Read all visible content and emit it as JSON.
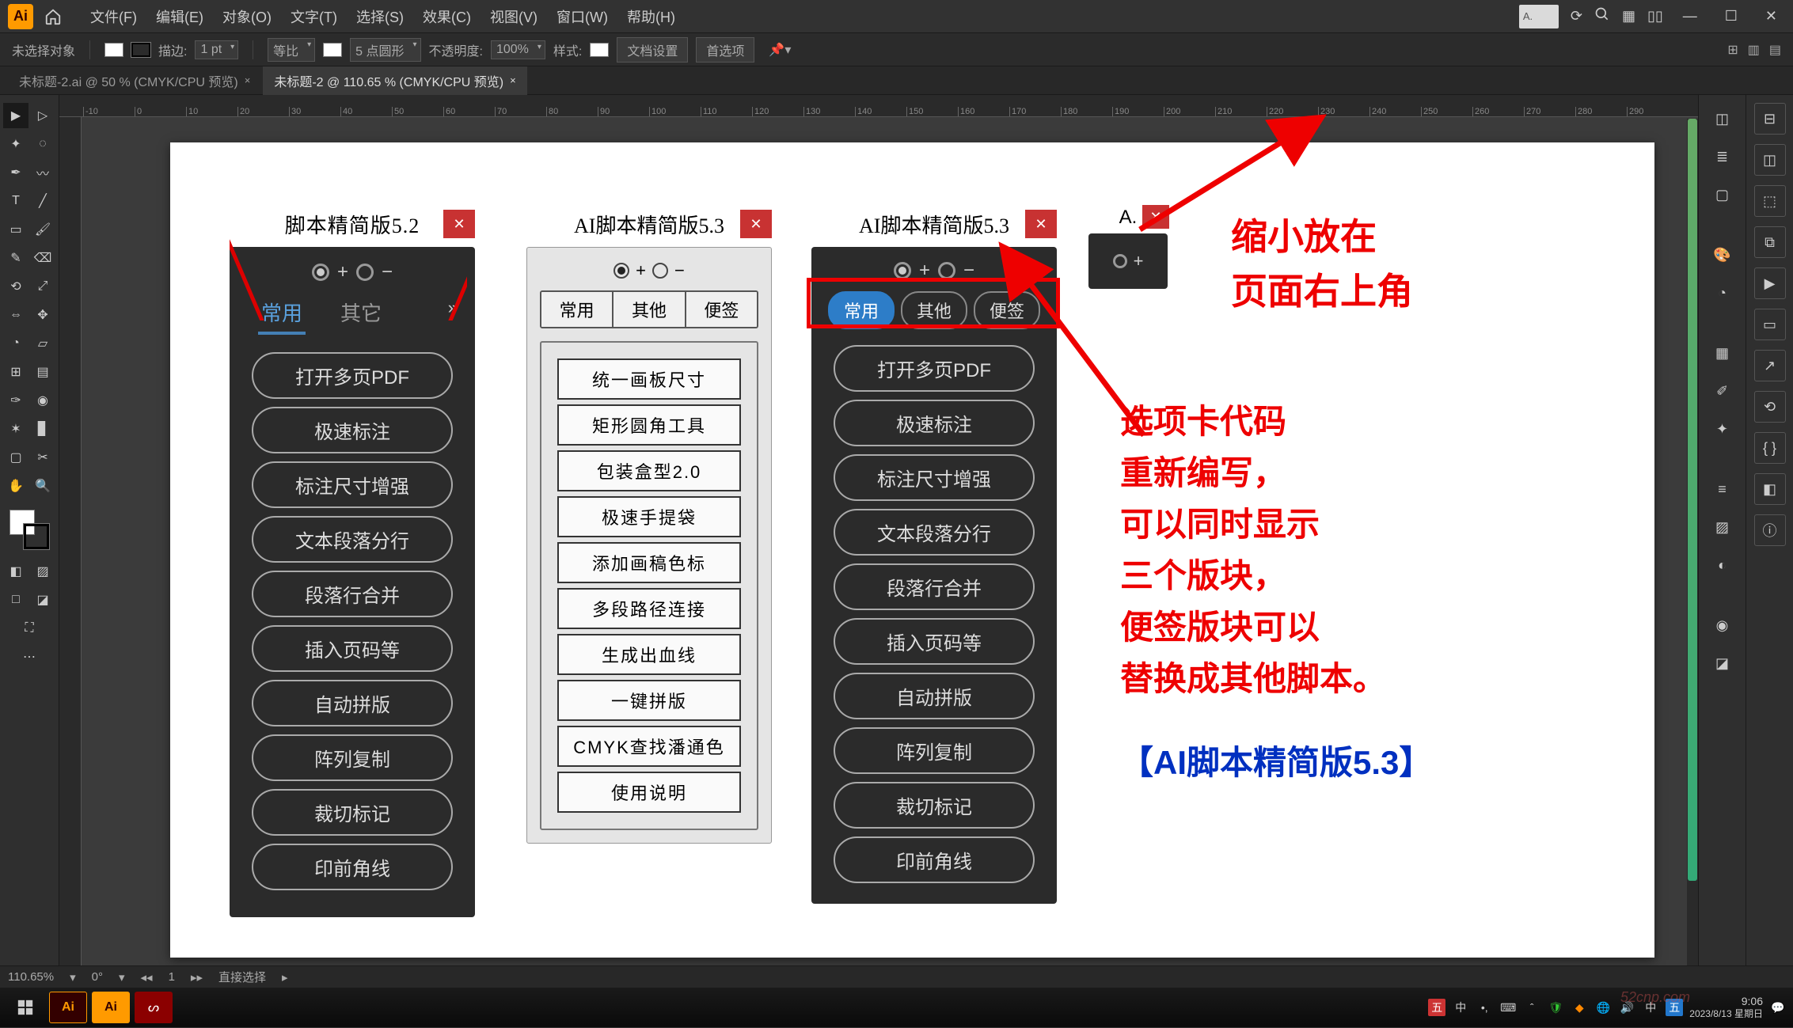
{
  "menubar": {
    "items": [
      "文件(F)",
      "编辑(E)",
      "对象(O)",
      "文字(T)",
      "选择(S)",
      "效果(C)",
      "视图(V)",
      "窗口(W)",
      "帮助(H)"
    ],
    "search_placeholder": "A..",
    "top_badge": "A."
  },
  "controlbar": {
    "no_selection": "未选择对象",
    "stroke_label": "描边:",
    "stroke_value": "1 pt",
    "uniform": "等比",
    "points_label": "5 点圆形",
    "opacity_label": "不透明度:",
    "opacity_value": "100%",
    "style_label": "样式:",
    "doc_setup": "文档设置",
    "prefs": "首选项"
  },
  "tabs": {
    "items": [
      {
        "label": "未标题-2.ai @ 50 % (CMYK/CPU 预览)",
        "active": false
      },
      {
        "label": "未标题-2 @ 110.65 % (CMYK/CPU 预览)",
        "active": true
      }
    ]
  },
  "ruler": {
    "marks": [
      "-10",
      "0",
      "10",
      "20",
      "30",
      "40",
      "50",
      "60",
      "70",
      "80",
      "90",
      "100",
      "110",
      "120",
      "130",
      "140",
      "150",
      "160",
      "170",
      "180",
      "190",
      "200",
      "210",
      "220",
      "230",
      "240",
      "250",
      "260",
      "270",
      "280",
      "290"
    ]
  },
  "panel52": {
    "title": "脚本精简版5.2",
    "tabs": {
      "a": "常用",
      "b": "其它"
    },
    "buttons": [
      "打开多页PDF",
      "极速标注",
      "标注尺寸增强",
      "文本段落分行",
      "段落行合并",
      "插入页码等",
      "自动拼版",
      "阵列复制",
      "裁切标记",
      "印前角线"
    ]
  },
  "panel53a": {
    "title": "AI脚本精简版5.3",
    "tabs": {
      "a": "常用",
      "b": "其他",
      "c": "便签"
    },
    "buttons": [
      "统一画板尺寸",
      "矩形圆角工具",
      "包装盒型2.0",
      "极速手提袋",
      "添加画稿色标",
      "多段路径连接",
      "生成出血线",
      "一键拼版",
      "CMYK查找潘通色",
      "使用说明"
    ]
  },
  "panel53b": {
    "title": "AI脚本精简版5.3",
    "tabs": {
      "a": "常用",
      "b": "其他",
      "c": "便签"
    },
    "buttons": [
      "打开多页PDF",
      "极速标注",
      "标注尺寸增强",
      "文本段落分行",
      "段落行合并",
      "插入页码等",
      "自动拼版",
      "阵列复制",
      "裁切标记",
      "印前角线"
    ]
  },
  "panel_mini": {
    "title": "A."
  },
  "annotations": {
    "a1_l1": "缩小放在",
    "a1_l2": "页面右上角",
    "a2_l1": "选项卡代码",
    "a2_l2": "重新编写，",
    "a2_l3": "可以同时显示",
    "a2_l4": "三个版块，",
    "a2_l5": "便签版块可以",
    "a2_l6": "替换成其他脚本。",
    "a3": "【AI脚本精简版5.3】"
  },
  "status": {
    "zoom": "110.65%",
    "rot": "0°",
    "art": "1",
    "mode": "直接选择"
  },
  "taskbar": {
    "ime": "中",
    "time": "9:06",
    "date": "2023/8/13 星期日"
  },
  "watermark": "52cnp.com"
}
